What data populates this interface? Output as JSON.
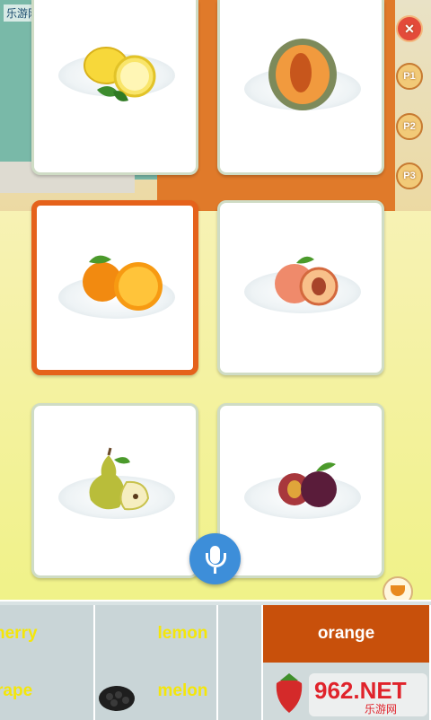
{
  "watermark": "乐游网 www.962.net",
  "side_buttons": {
    "close": "✕",
    "p1": "P1",
    "p2": "P2",
    "p3": "P3"
  },
  "cards": [
    {
      "fruit": "lemon",
      "selected": false
    },
    {
      "fruit": "melon",
      "selected": false
    },
    {
      "fruit": "orange",
      "selected": true
    },
    {
      "fruit": "peach",
      "selected": false
    },
    {
      "fruit": "pear",
      "selected": false
    },
    {
      "fruit": "plum",
      "selected": false
    }
  ],
  "word_tray": {
    "row1": [
      "herry",
      "lemon",
      "",
      "orange"
    ],
    "row2": [
      "rape",
      "melon",
      "",
      ""
    ],
    "active_word": "orange"
  },
  "logo_text": {
    "main": "962.NET",
    "sub": "乐游网"
  },
  "colors": {
    "selected": "#e5621b",
    "tray_text": "#f4e60a",
    "mic": "#3d8ed9"
  }
}
